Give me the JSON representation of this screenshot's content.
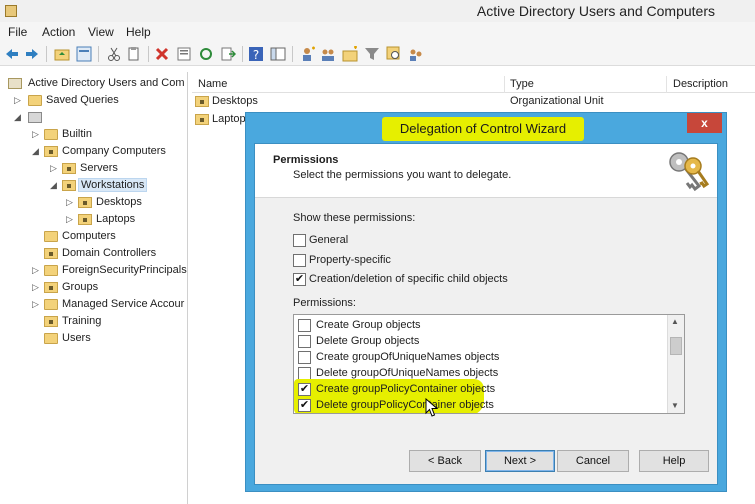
{
  "window": {
    "title": "Active Directory Users and Computers"
  },
  "menu": [
    "File",
    "Action",
    "View",
    "Help"
  ],
  "toolbar_icons": [
    "back-arrow-icon",
    "forward-arrow-icon",
    "up-folder-icon",
    "properties-icon",
    "cut-icon",
    "copy-icon",
    "delete-icon",
    "refresh-icon",
    "export-icon",
    "help-icon",
    "console-tree-icon",
    "new-user-icon",
    "new-group-icon",
    "new-ou-icon",
    "filter-icon",
    "find-icon",
    "delegate-icon"
  ],
  "tree": {
    "root": "Active Directory Users and Com",
    "saved_queries": "Saved Queries",
    "builtin": "Builtin",
    "company_computers": "Company Computers",
    "servers": "Servers",
    "workstations": "Workstations",
    "desktops": "Desktops",
    "laptops": "Laptops",
    "computers": "Computers",
    "domain_controllers": "Domain Controllers",
    "foreign": "ForeignSecurityPrincipals",
    "groups": "Groups",
    "msa": "Managed Service Accour",
    "training": "Training",
    "users": "Users"
  },
  "list": {
    "columns": [
      "Name",
      "Type",
      "Description"
    ],
    "rows": [
      {
        "name": "Desktops",
        "type": "Organizational Unit"
      },
      {
        "name": "Laptop",
        "type": ""
      }
    ]
  },
  "dialog": {
    "title": "Delegation of Control Wizard",
    "close": "x",
    "header": "Permissions",
    "subheader": "Select the permissions you want to delegate.",
    "show_label": "Show these permissions:",
    "show_options": [
      {
        "label": "General",
        "checked": false
      },
      {
        "label": "Property-specific",
        "checked": false
      },
      {
        "label": "Creation/deletion of specific child objects",
        "checked": true
      }
    ],
    "permissions_label": "Permissions:",
    "permissions": [
      {
        "label": "Create Group objects",
        "checked": false
      },
      {
        "label": "Delete Group objects",
        "checked": false
      },
      {
        "label": "Create groupOfUniqueNames objects",
        "checked": false
      },
      {
        "label": "Delete groupOfUniqueNames objects",
        "checked": false
      },
      {
        "label": "Create groupPolicyContainer objects",
        "checked": true
      },
      {
        "label": "Delete groupPolicyContainer objects",
        "checked": true
      }
    ],
    "buttons": {
      "back": "< Back",
      "next": "Next >",
      "cancel": "Cancel",
      "help": "Help"
    }
  },
  "colors": {
    "dialog_frame": "#4aa8de",
    "highlight": "#e6ef00",
    "close": "#c7473a"
  }
}
